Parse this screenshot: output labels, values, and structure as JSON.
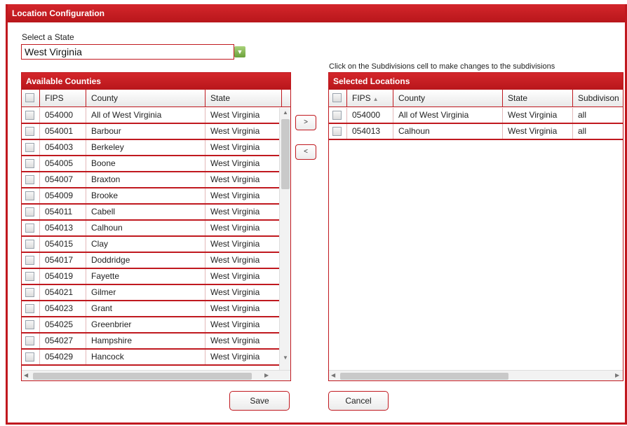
{
  "window": {
    "title": "Location Configuration"
  },
  "state_select": {
    "label": "Select a State",
    "value": "West Virginia",
    "icon": "dropdown-arrow-icon"
  },
  "hint": "Click on the Subdivisions cell to make changes to the subdivisions",
  "available": {
    "title": "Available Counties",
    "columns": {
      "fips": "FIPS",
      "county": "County",
      "state": "State"
    },
    "rows": [
      {
        "fips": "054000",
        "county": "All of West Virginia",
        "state": "West Virginia"
      },
      {
        "fips": "054001",
        "county": "Barbour",
        "state": "West Virginia"
      },
      {
        "fips": "054003",
        "county": "Berkeley",
        "state": "West Virginia"
      },
      {
        "fips": "054005",
        "county": "Boone",
        "state": "West Virginia"
      },
      {
        "fips": "054007",
        "county": "Braxton",
        "state": "West Virginia"
      },
      {
        "fips": "054009",
        "county": "Brooke",
        "state": "West Virginia"
      },
      {
        "fips": "054011",
        "county": "Cabell",
        "state": "West Virginia"
      },
      {
        "fips": "054013",
        "county": "Calhoun",
        "state": "West Virginia"
      },
      {
        "fips": "054015",
        "county": "Clay",
        "state": "West Virginia"
      },
      {
        "fips": "054017",
        "county": "Doddridge",
        "state": "West Virginia"
      },
      {
        "fips": "054019",
        "county": "Fayette",
        "state": "West Virginia"
      },
      {
        "fips": "054021",
        "county": "Gilmer",
        "state": "West Virginia"
      },
      {
        "fips": "054023",
        "county": "Grant",
        "state": "West Virginia"
      },
      {
        "fips": "054025",
        "county": "Greenbrier",
        "state": "West Virginia"
      },
      {
        "fips": "054027",
        "county": "Hampshire",
        "state": "West Virginia"
      },
      {
        "fips": "054029",
        "county": "Hancock",
        "state": "West Virginia"
      }
    ]
  },
  "selected": {
    "title": "Selected Locations",
    "columns": {
      "fips": "FIPS",
      "county": "County",
      "state": "State",
      "subdivisions": "Subdivison"
    },
    "rows": [
      {
        "fips": "054000",
        "county": "All of West Virginia",
        "state": "West Virginia",
        "subdivisions": "all"
      },
      {
        "fips": "054013",
        "county": "Calhoun",
        "state": "West Virginia",
        "subdivisions": "all"
      }
    ]
  },
  "buttons": {
    "add": ">",
    "remove": "<",
    "save": "Save",
    "cancel": "Cancel"
  },
  "colors": {
    "accent": "#c0191f",
    "dropdown": "#7fb84a"
  }
}
